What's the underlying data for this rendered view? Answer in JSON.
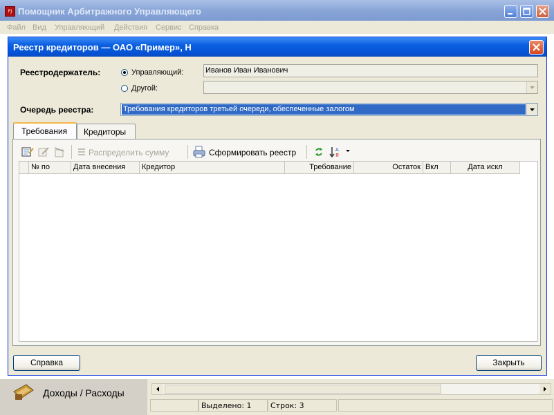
{
  "app": {
    "title": "Помощник Арбитражного Управляющего",
    "icon": "app-logo-icon"
  },
  "menu": {
    "items": [
      "Файл",
      "Вид",
      "Управляющий",
      "Действия",
      "Сервис",
      "Справка"
    ]
  },
  "dialog": {
    "title": "Реестр кредиторов — ОАО «Пример», Н",
    "holder_label": "Реестродержатель:",
    "radio_manager": "Управляющий:",
    "radio_other": "Другой:",
    "manager_value": "Иванов Иван Иванович",
    "other_value": "",
    "queue_label": "Очередь реестра:",
    "queue_value": "Требования кредиторов третьей очереди, обеспеченные залогом",
    "tabs": [
      "Требования",
      "Кредиторы"
    ],
    "toolbar": {
      "distribute": "Распределить сумму",
      "build": "Сформировать реестр"
    },
    "columns": [
      "№ по",
      "Дата внесения",
      "Кредитор",
      "Требование",
      "Остаток",
      "Вкл",
      "Дата искл"
    ],
    "help_button": "Справка",
    "close_button": "Закрыть"
  },
  "sidebar": {
    "income_label": "Доходы / Расходы"
  },
  "status": {
    "selected": "Выделено: 1",
    "rows": "Строк: 3"
  },
  "colors": {
    "dialog_title": "#0553d6",
    "selection": "#316ac5",
    "tab_highlight": "#f5b642"
  }
}
